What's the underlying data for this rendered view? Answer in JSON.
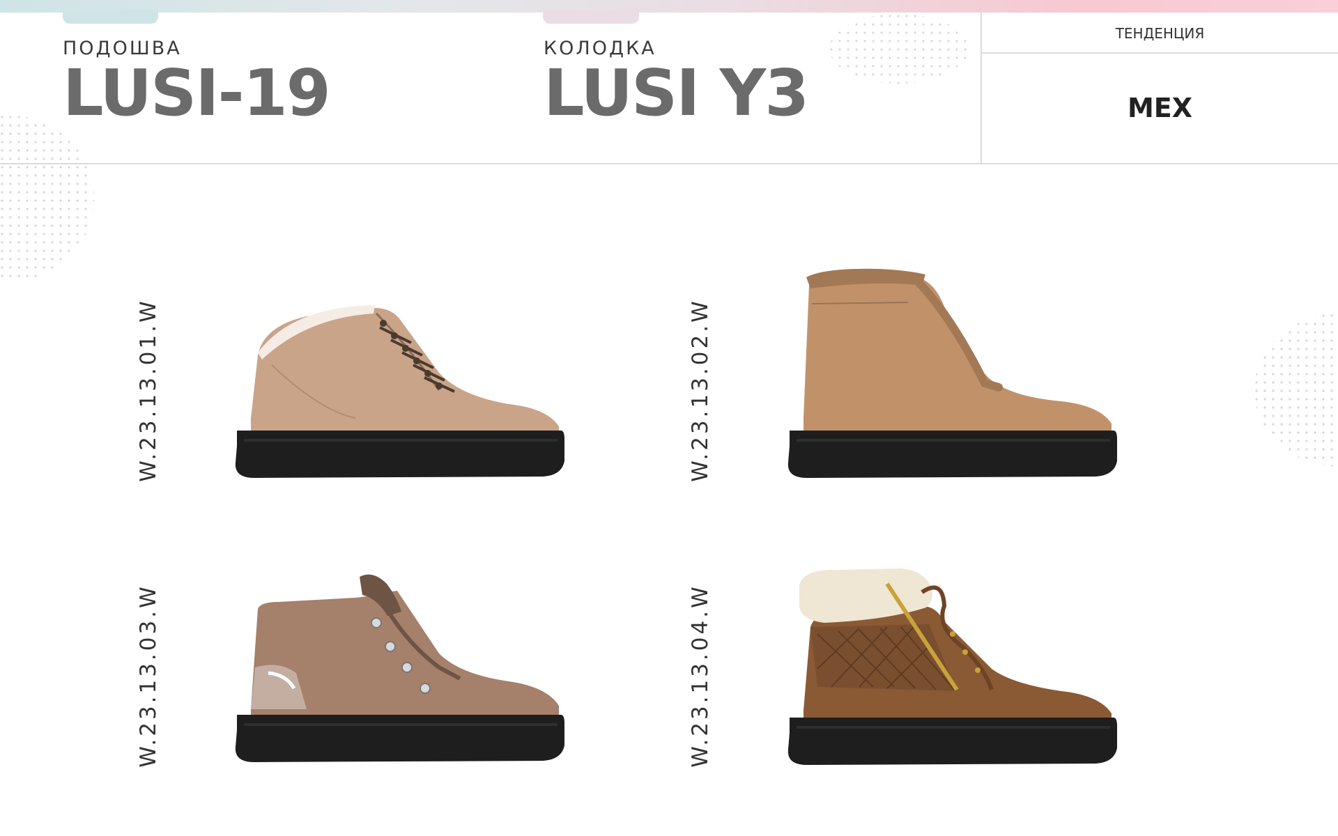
{
  "header": {
    "sole_caption": "ПОДОШВА",
    "sole_value": "LUSI-19",
    "last_caption": "КОЛОДКА",
    "last_value": "LUSI Y3",
    "trend_caption": "ТЕНДЕНЦИЯ",
    "trend_value": "МЕХ"
  },
  "products": [
    {
      "code": "W.23.13.01.W",
      "image_icon": "leather-sneaker-boot-beige-icon",
      "colors": {
        "upper": "#c9a489",
        "sole": "#1e1e1e"
      }
    },
    {
      "code": "W.23.13.02.W",
      "image_icon": "leather-high-boot-camel-icon",
      "colors": {
        "upper": "#c1926a",
        "sole": "#1e1e1e"
      }
    },
    {
      "code": "W.23.13.03.W",
      "image_icon": "suede-hiker-boot-taupe-icon",
      "colors": {
        "upper": "#a5806a",
        "sole": "#1e1e1e"
      }
    },
    {
      "code": "W.23.13.04.W",
      "image_icon": "quilted-suede-boot-brown-icon",
      "colors": {
        "upper": "#8a5a35",
        "sole": "#1e1e1e"
      }
    }
  ],
  "colors": {
    "title_gray": "#6b6b6b",
    "divider": "#dcdcdc",
    "gradient_left": "#cfe4e6",
    "gradient_right": "#f9d0d8"
  }
}
